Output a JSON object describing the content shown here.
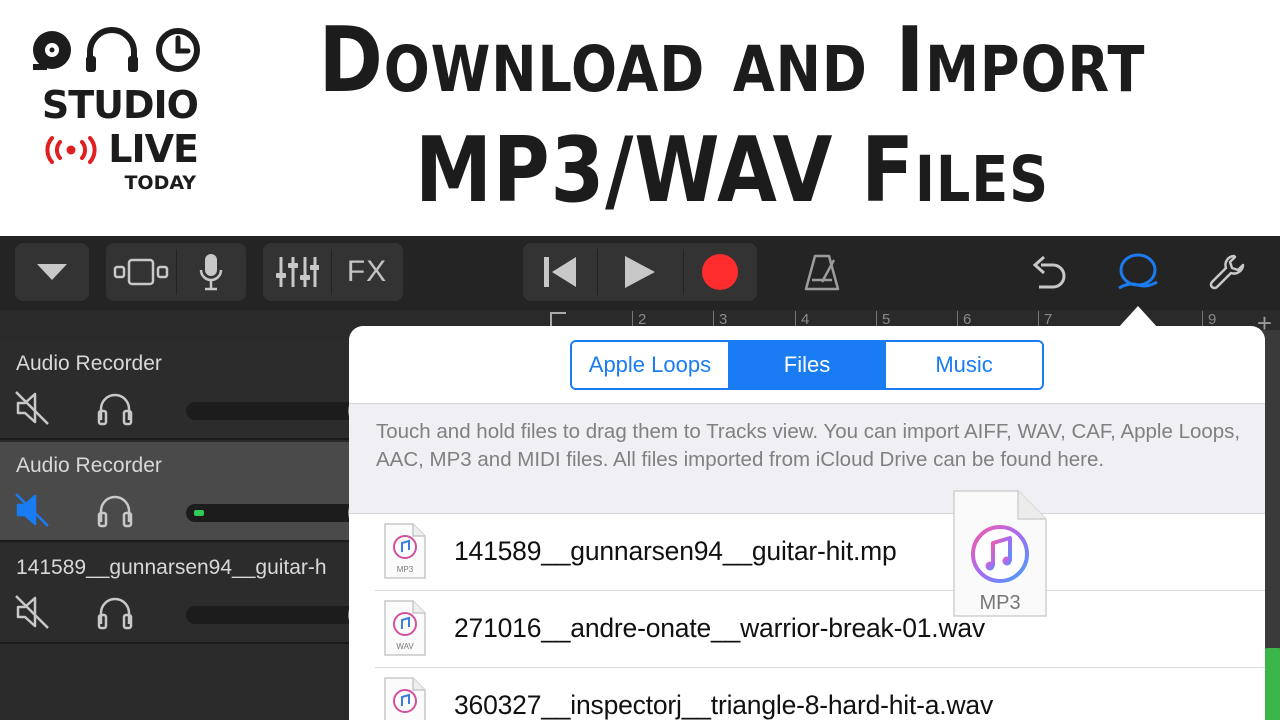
{
  "banner": {
    "logo": {
      "studio": "STUDIO",
      "live": "LIVE",
      "today": "TODAY"
    },
    "headline_line1": "Download and Import",
    "headline_line2": "MP3/WAV Files"
  },
  "toolbar": {
    "buttons": [
      "tracks-menu",
      "tracks-view",
      "microphone",
      "mixer",
      "FX",
      "rewind",
      "play",
      "record",
      "metronome",
      "undo",
      "loop-browser",
      "settings"
    ],
    "fx_label": "FX",
    "accent_color": "#1a7cf3",
    "record_color": "#ff2d2d"
  },
  "ruler": {
    "bars": [
      "2",
      "3",
      "4",
      "5",
      "6",
      "7",
      "9"
    ]
  },
  "tracks": [
    {
      "name": "Audio Recorder",
      "muted": false,
      "selected": false
    },
    {
      "name": "Audio Recorder",
      "muted": true,
      "selected": true
    },
    {
      "name": "141589__gunnarsen94__guitar-h",
      "muted": false,
      "selected": false
    }
  ],
  "browser": {
    "tabs": [
      "Apple Loops",
      "Files",
      "Music"
    ],
    "active_tab": "Files",
    "hint": "Touch and hold files to drag them to Tracks view. You can import AIFF, WAV, CAF, Apple Loops, AAC, MP3 and MIDI files. All files imported from iCloud Drive can be found here.",
    "files": [
      {
        "name": "141589__gunnarsen94__guitar-hit.mp",
        "type": "MP3"
      },
      {
        "name": "271016__andre-onate__warrior-break-01.wav",
        "type": "WAV"
      },
      {
        "name": "360327__inspectorj__triangle-8-hard-hit-a.wav",
        "type": "WAV"
      }
    ],
    "drag_ghost_label": "MP3"
  }
}
